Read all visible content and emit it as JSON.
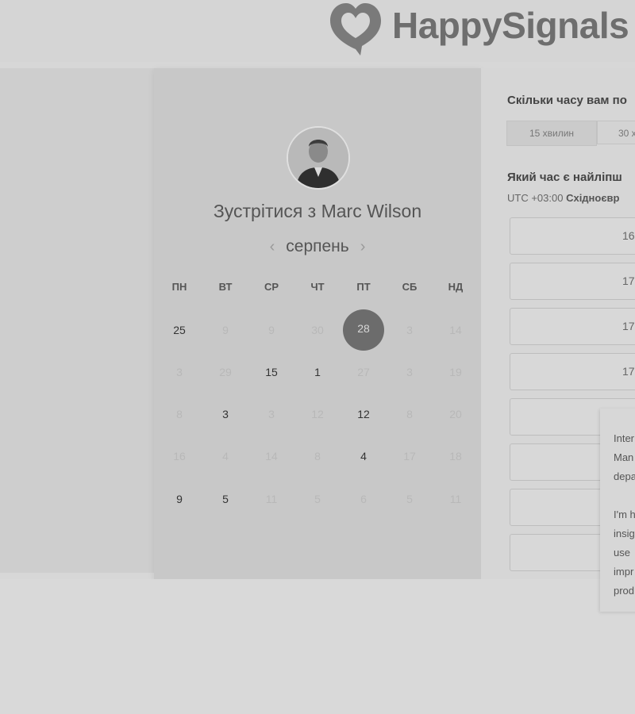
{
  "header": {
    "logo_text": "HappySignals",
    "logo_icon": "heart-speech-bubble-icon"
  },
  "calendar": {
    "title": "Зустрітися з Marc Wilson",
    "month": "серпень",
    "prev_icon": "chevron-left-icon",
    "next_icon": "chevron-right-icon",
    "weekdays": [
      "ПН",
      "ВТ",
      "СР",
      "ЧТ",
      "ПТ",
      "СБ",
      "НД"
    ],
    "weeks": [
      [
        {
          "d": "25",
          "s": "avail"
        },
        {
          "d": "9",
          "s": "off"
        },
        {
          "d": "9",
          "s": "off"
        },
        {
          "d": "30",
          "s": "off"
        },
        {
          "d": "28",
          "s": "selected"
        },
        {
          "d": "3",
          "s": "off"
        },
        {
          "d": "14",
          "s": "off"
        }
      ],
      [
        {
          "d": "3",
          "s": "off"
        },
        {
          "d": "29",
          "s": "off"
        },
        {
          "d": "15",
          "s": "avail"
        },
        {
          "d": "1",
          "s": "avail"
        },
        {
          "d": "27",
          "s": "off"
        },
        {
          "d": "3",
          "s": "off"
        },
        {
          "d": "19",
          "s": "off"
        }
      ],
      [
        {
          "d": "8",
          "s": "off"
        },
        {
          "d": "3",
          "s": "avail"
        },
        {
          "d": "3",
          "s": "off"
        },
        {
          "d": "12",
          "s": "off"
        },
        {
          "d": "12",
          "s": "avail"
        },
        {
          "d": "8",
          "s": "off"
        },
        {
          "d": "20",
          "s": "off"
        }
      ],
      [
        {
          "d": "16",
          "s": "off"
        },
        {
          "d": "4",
          "s": "off"
        },
        {
          "d": "14",
          "s": "off"
        },
        {
          "d": "8",
          "s": "off"
        },
        {
          "d": "4",
          "s": "avail"
        },
        {
          "d": "17",
          "s": "off"
        },
        {
          "d": "18",
          "s": "off"
        }
      ],
      [
        {
          "d": "9",
          "s": "avail"
        },
        {
          "d": "5",
          "s": "avail"
        },
        {
          "d": "11",
          "s": "off"
        },
        {
          "d": "5",
          "s": "off"
        },
        {
          "d": "6",
          "s": "off"
        },
        {
          "d": "5",
          "s": "off"
        },
        {
          "d": "11",
          "s": "off"
        }
      ]
    ]
  },
  "booking": {
    "duration_question": "Скільки часу вам по",
    "durations": [
      "15 хвилин",
      "30 х"
    ],
    "time_question": "Який час є найліпш",
    "timezone_offset": "UTC +03:00",
    "timezone_name": "Східноєвр",
    "slots": [
      "16",
      "17",
      "17",
      "17",
      "",
      "",
      "",
      ""
    ]
  },
  "popup": {
    "para1": [
      "Inter",
      "Man",
      "depa"
    ],
    "para2": [
      "I'm h",
      "insig",
      "use",
      "impr",
      "prod"
    ]
  }
}
